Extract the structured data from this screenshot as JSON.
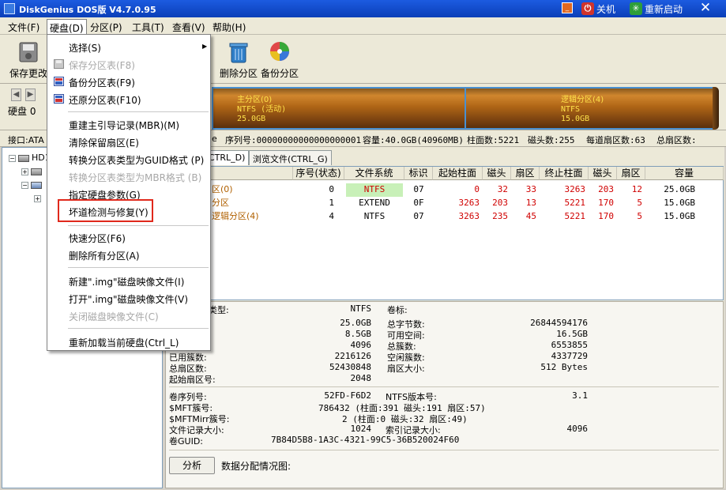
{
  "titlebar": {
    "title": "DiskGenius DOS版 V4.7.0.95",
    "shutdown_label": "关机",
    "restart_label": "重新启动",
    "close_glyph": "✕"
  },
  "menubar": {
    "items": [
      "文件(F)",
      "硬盘(D)",
      "分区(P)",
      "工具(T)",
      "查看(V)",
      "帮助(H)"
    ]
  },
  "toolbar": {
    "buttons": [
      "保存更改",
      "删除分区",
      "备份分区"
    ]
  },
  "disk": {
    "label": "硬盘 0",
    "interface_label": "接口:ATA",
    "partitions": [
      {
        "name": "主分区(0)",
        "fs": "NTFS (活动)",
        "size": "25.0GB"
      },
      {
        "name": "逻辑分区(4)",
        "fs": "NTFS",
        "size": "15.0GB"
      }
    ]
  },
  "infobar": {
    "model_tail": "e",
    "serial": "序列号:00000000000000000001",
    "capacity": "容量:40.0GB(40960MB)",
    "cylinders": "柱面数:5221",
    "heads": "磁头数:255",
    "sectors_per_track": "每道扇区数:63",
    "total_sectors": "总扇区数:"
  },
  "tree": {
    "root_label": "HD1",
    "expand_minus": "−",
    "expand_plus": "+"
  },
  "tabs": [
    "CTRL_D)",
    "浏览文件(CTRL_G)"
  ],
  "table": {
    "headers": [
      "序号(状态)",
      "文件系统",
      "标识",
      "起始柱面",
      "磁头",
      "扇区",
      "终止柱面",
      "磁头",
      "扇区",
      "容量"
    ],
    "rows": [
      {
        "name": "区(0)",
        "no": "0",
        "fs": "NTFS",
        "id": "07",
        "sc": "0",
        "sh": "32",
        "ss": "33",
        "ec": "3263",
        "eh": "203",
        "es": "12",
        "cap": "25.0GB"
      },
      {
        "name": "分区",
        "no": "1",
        "fs": "EXTEND",
        "id": "0F",
        "sc": "3263",
        "sh": "203",
        "ss": "13",
        "ec": "5221",
        "eh": "170",
        "es": "5",
        "cap": "15.0GB"
      },
      {
        "name": "逻辑分区(4)",
        "no": "4",
        "fs": "NTFS",
        "id": "07",
        "sc": "3263",
        "sh": "235",
        "ss": "45",
        "ec": "5221",
        "eh": "170",
        "es": "5",
        "cap": "15.0GB"
      }
    ]
  },
  "details": {
    "type_label": "类型:",
    "type_value": "NTFS",
    "vol_label_label": "卷标:",
    "left_values": [
      "25.0GB",
      "8.5GB",
      "4096",
      "2216126",
      "52430848",
      "2048"
    ],
    "left_labels": [
      "已用簇数:",
      "总扇区数:",
      "起始扇区号:"
    ],
    "right_labels": [
      "总字节数:",
      "可用空间:",
      "总簇数:",
      "空闲簇数:",
      "扇区大小:"
    ],
    "right_values": [
      "26844594176",
      "16.5GB",
      "6553855",
      "4337729",
      "512 Bytes"
    ],
    "ntfs_labels": [
      "卷序列号:",
      "$MFT簇号:",
      "$MFTMirr簇号:",
      "文件记录大小:",
      "卷GUID:"
    ],
    "ntfs_values": [
      "52FD-F6D2",
      "786432 (柱面:391 磁头:191 扇区:57)",
      "2 (柱面:0 磁头:32 扇区:49)",
      "1024",
      "7B84D5B8-1A3C-4321-99C5-36B520024F60"
    ],
    "ntfs_right_labels": [
      "NTFS版本号:",
      "索引记录大小:"
    ],
    "ntfs_right_values": [
      "3.1",
      "4096"
    ],
    "analyze_button": "分析",
    "allocation_label": "数据分配情况图:"
  },
  "dropdown": {
    "items": [
      {
        "label": "选择(S)",
        "disabled": false
      },
      {
        "label": "保存分区表(F8)",
        "disabled": true
      },
      {
        "label": "备份分区表(F9)",
        "disabled": false
      },
      {
        "label": "还原分区表(F10)",
        "disabled": false
      },
      {
        "label": "重建主引导记录(MBR)(M)",
        "disabled": false
      },
      {
        "label": "清除保留扇区(E)",
        "disabled": false
      },
      {
        "label": "转换分区表类型为GUID格式 (P)",
        "disabled": false
      },
      {
        "label": "转换分区表类型为MBR格式 (B)",
        "disabled": true
      },
      {
        "label": "指定硬盘参数(G)",
        "disabled": false
      },
      {
        "label": "坏道检测与修复(Y)",
        "disabled": false
      },
      {
        "label": "快速分区(F6)",
        "disabled": false
      },
      {
        "label": "删除所有分区(A)",
        "disabled": false
      },
      {
        "label": "新建\".img\"磁盘映像文件(I)",
        "disabled": false
      },
      {
        "label": "打开\".img\"磁盘映像文件(V)",
        "disabled": false
      },
      {
        "label": "关闭磁盘映像文件(C)",
        "disabled": true
      },
      {
        "label": "重新加载当前硬盘(Ctrl_L)",
        "disabled": false
      }
    ],
    "submenu_arrow": "▶"
  }
}
